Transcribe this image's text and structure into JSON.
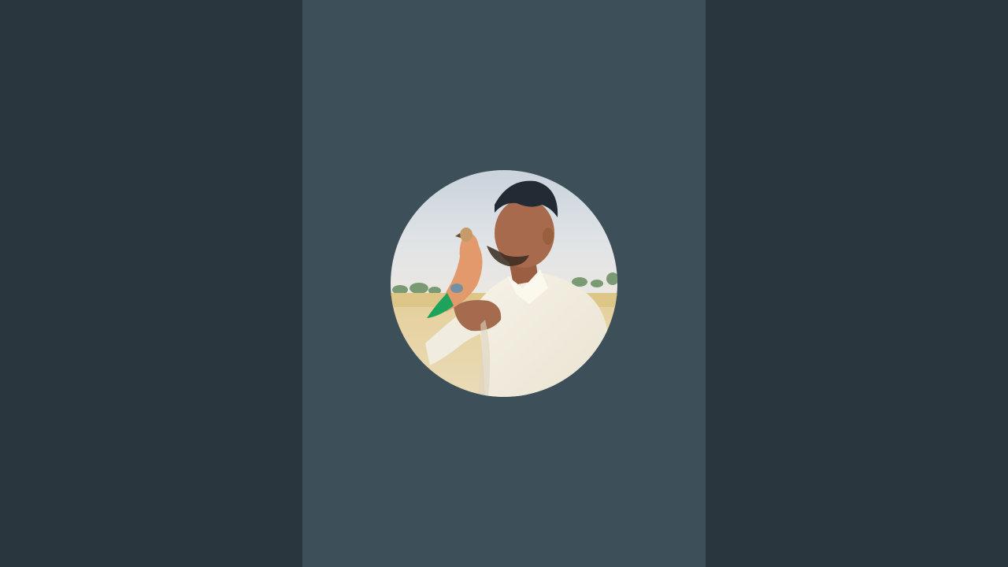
{
  "background": {
    "outer_color": "#2a363e",
    "panel_color": "#3d4f59"
  },
  "avatar": {
    "shape": "circle",
    "subject": "profile-photo"
  }
}
